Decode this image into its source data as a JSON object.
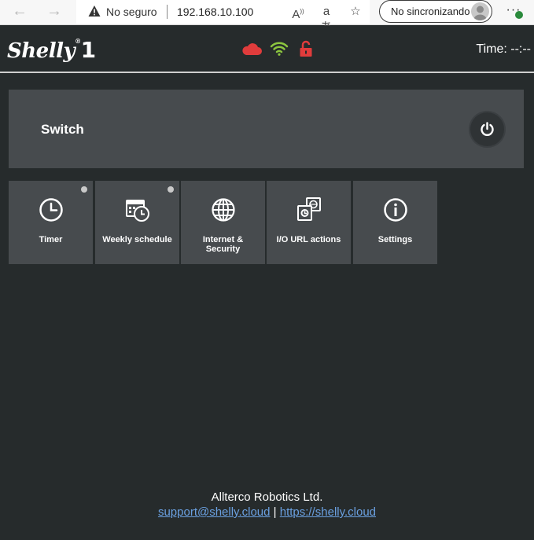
{
  "browser": {
    "not_secure_label": "No seguro",
    "url": "192.168.10.100",
    "sync_label": "No sincronizando",
    "back_icon": "arrow-left-icon",
    "forward_icon": "arrow-right-icon",
    "more_label": "···"
  },
  "header": {
    "logo_text": "Shelly",
    "logo_model": "1",
    "logo_mark": "®",
    "status_icons": [
      "cloud-icon",
      "wifi-icon",
      "lock-open-icon"
    ],
    "status_colors": {
      "cloud": "#e03c3c",
      "wifi": "#8cc63f",
      "lock": "#e03c3c"
    },
    "time_label": "Time: --:--"
  },
  "switch": {
    "title": "Switch",
    "power_icon": "power-icon"
  },
  "tiles": [
    {
      "label": "Timer",
      "icon": "clock-icon",
      "dot": true
    },
    {
      "label": "Weekly schedule",
      "icon": "calendar-clock-icon",
      "dot": true
    },
    {
      "label": "Internet & Security",
      "icon": "globe-icon",
      "dot": false
    },
    {
      "label": "I/O URL actions",
      "icon": "url-actions-icon",
      "dot": false
    },
    {
      "label": "Settings",
      "icon": "info-icon",
      "dot": false
    }
  ],
  "footer": {
    "company": "Allterco Robotics Ltd.",
    "email": "support@shelly.cloud",
    "separator": "|",
    "website": "https://shelly.cloud"
  }
}
